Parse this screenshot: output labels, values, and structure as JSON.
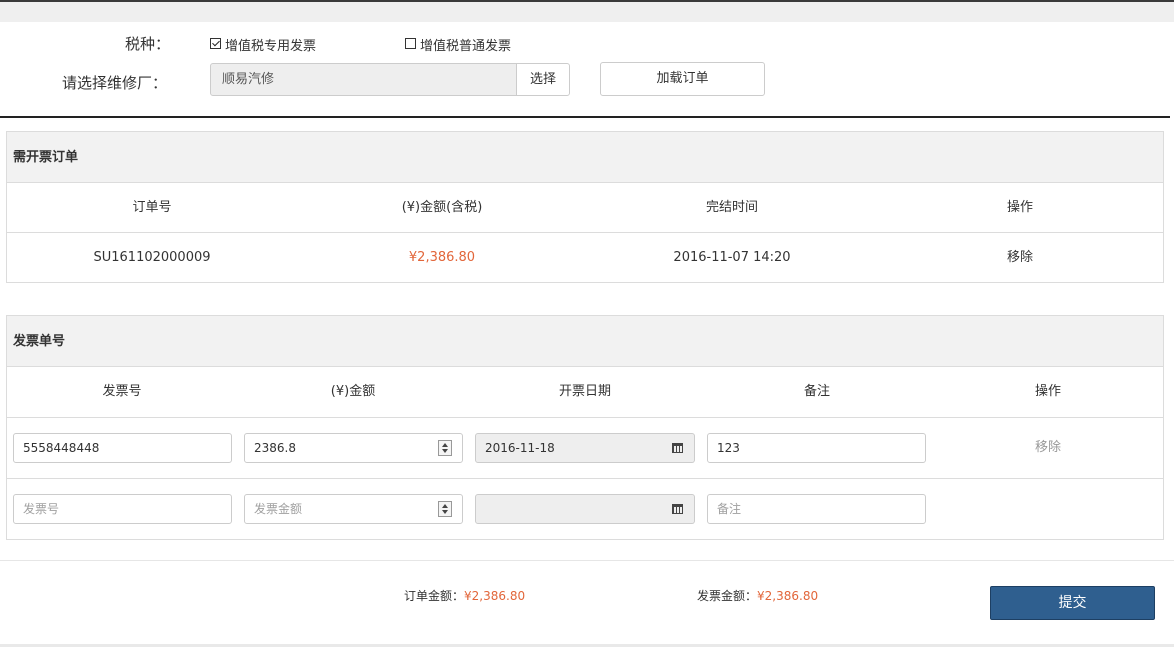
{
  "form": {
    "tax_type_label": "税种：",
    "tax_options": [
      {
        "label": "增值税专用发票",
        "checked": true
      },
      {
        "label": "增值税普通发票",
        "checked": false
      }
    ],
    "repair_shop_label": "请选择维修厂：",
    "repair_shop_value": "顺易汽修",
    "select_button": "选择",
    "load_orders_button": "加载订单"
  },
  "orders_panel": {
    "title": "需开票订单",
    "headers": [
      "订单号",
      "(¥)金额(含税)",
      "完结时间",
      "操作"
    ],
    "rows": [
      {
        "order_no": "SU161102000009",
        "amount": "¥2,386.80",
        "finished_at": "2016-11-07 14:20",
        "action": "移除"
      }
    ]
  },
  "invoice_panel": {
    "title": "发票单号",
    "headers": [
      "发票号",
      "(¥)金额",
      "开票日期",
      "备注",
      "操作"
    ],
    "rows": [
      {
        "invoice_no": "5558448448",
        "amount": "2386.8",
        "date": "2016-11-18",
        "note": "123",
        "action": "移除"
      }
    ],
    "new_row": {
      "invoice_no_placeholder": "发票号",
      "amount_placeholder": "发票金额",
      "note_placeholder": "备注"
    }
  },
  "footer": {
    "order_total_label": "订单金额：",
    "order_total_value": "¥2,386.80",
    "invoice_total_label": "发票金额：",
    "invoice_total_value": "¥2,386.80",
    "submit_button": "提交"
  },
  "colors": {
    "accent_amount": "#e2663a",
    "submit_bg": "#2f5f8f"
  },
  "icons": {
    "calendar": "calendar-icon",
    "spinner": "number-spinner-icon",
    "checkbox": "checkbox-icon"
  }
}
